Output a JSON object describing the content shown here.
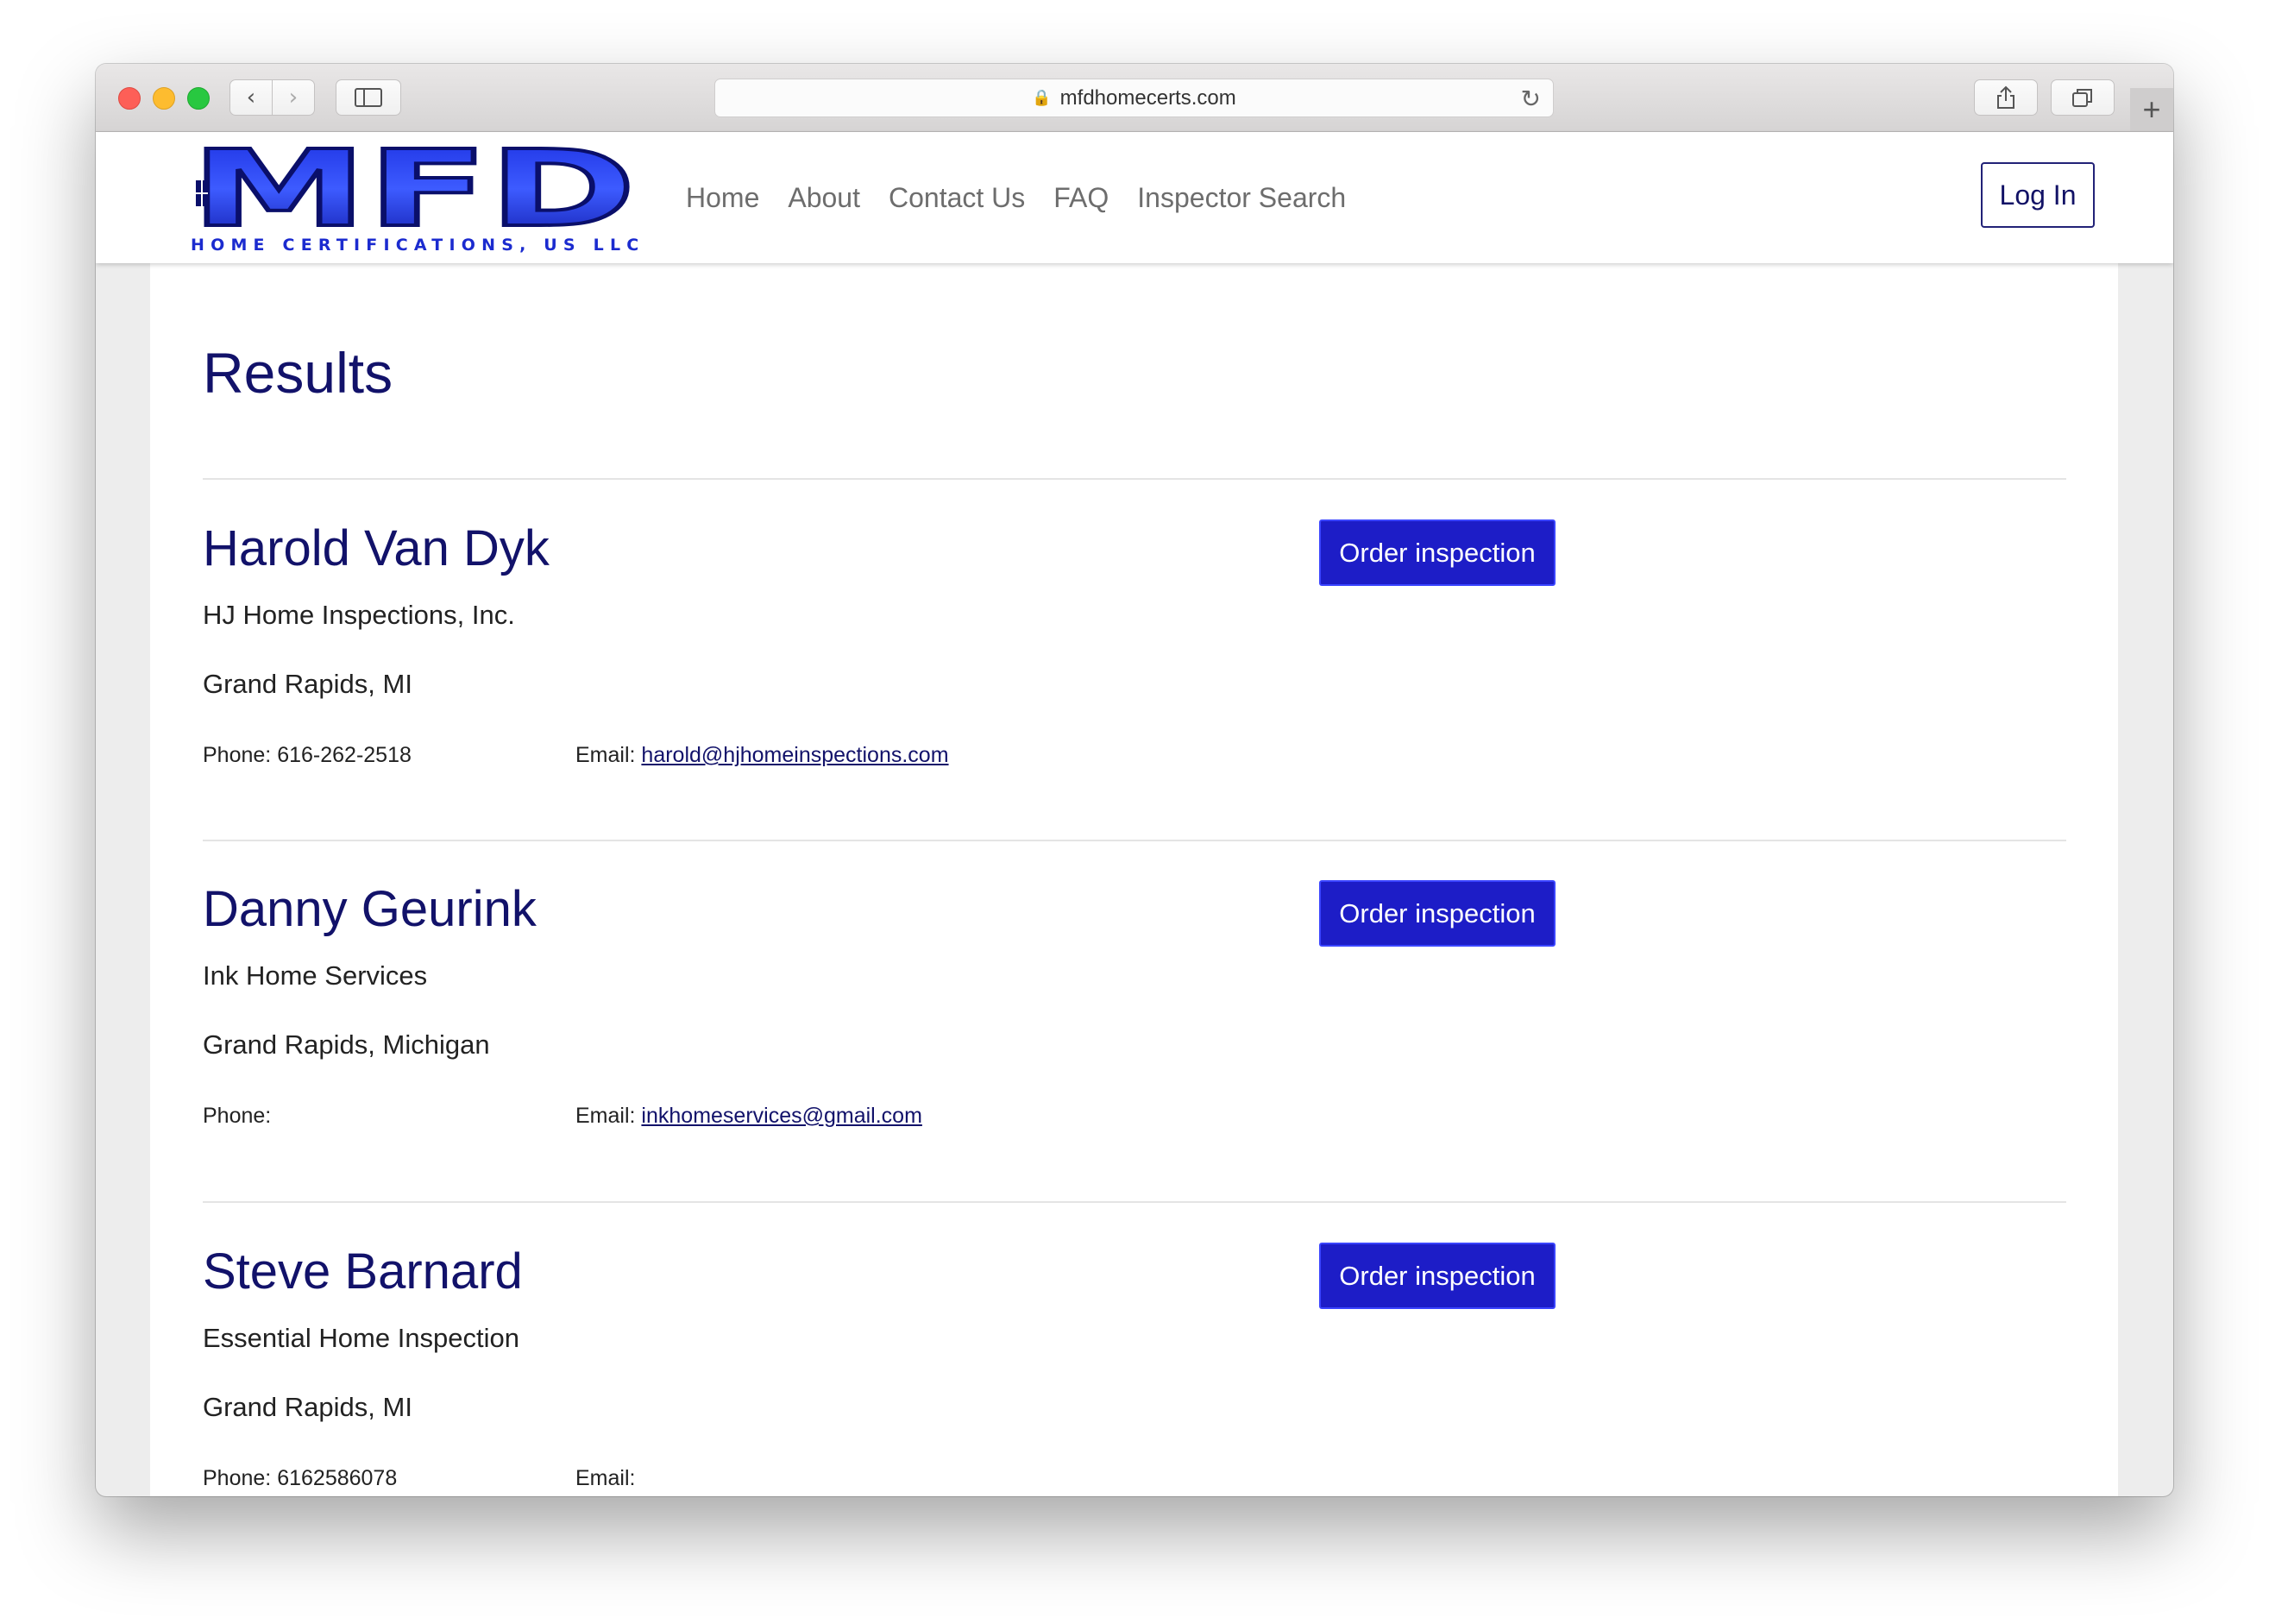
{
  "browser": {
    "url": "mfdhomecerts.com",
    "new_tab_label": "+"
  },
  "site": {
    "logo_text": "MFD",
    "logo_subtitle": "HOME CERTIFICATIONS, US LLC",
    "nav": [
      {
        "label": "Home"
      },
      {
        "label": "About"
      },
      {
        "label": "Contact Us"
      },
      {
        "label": "FAQ"
      },
      {
        "label": "Inspector Search"
      }
    ],
    "login_label": "Log In"
  },
  "page": {
    "title": "Results",
    "order_label": "Order inspection",
    "phone_label": "Phone:",
    "email_label": "Email:",
    "results": [
      {
        "name": "Harold Van Dyk",
        "company": "HJ Home Inspections, Inc.",
        "location": "Grand Rapids, MI",
        "phone": "616-262-2518",
        "email": "harold@hjhomeinspections.com"
      },
      {
        "name": "Danny Geurink",
        "company": "Ink Home Services",
        "location": "Grand Rapids, Michigan",
        "phone": "",
        "email": "inkhomeservices@gmail.com"
      },
      {
        "name": "Steve Barnard",
        "company": "Essential Home Inspection",
        "location": "Grand Rapids, MI",
        "phone": "6162586078",
        "email": ""
      }
    ]
  },
  "colors": {
    "brand_navy": "#12126a",
    "button_blue": "#1d1dc7",
    "logo_blue": "#1b2bcf"
  }
}
